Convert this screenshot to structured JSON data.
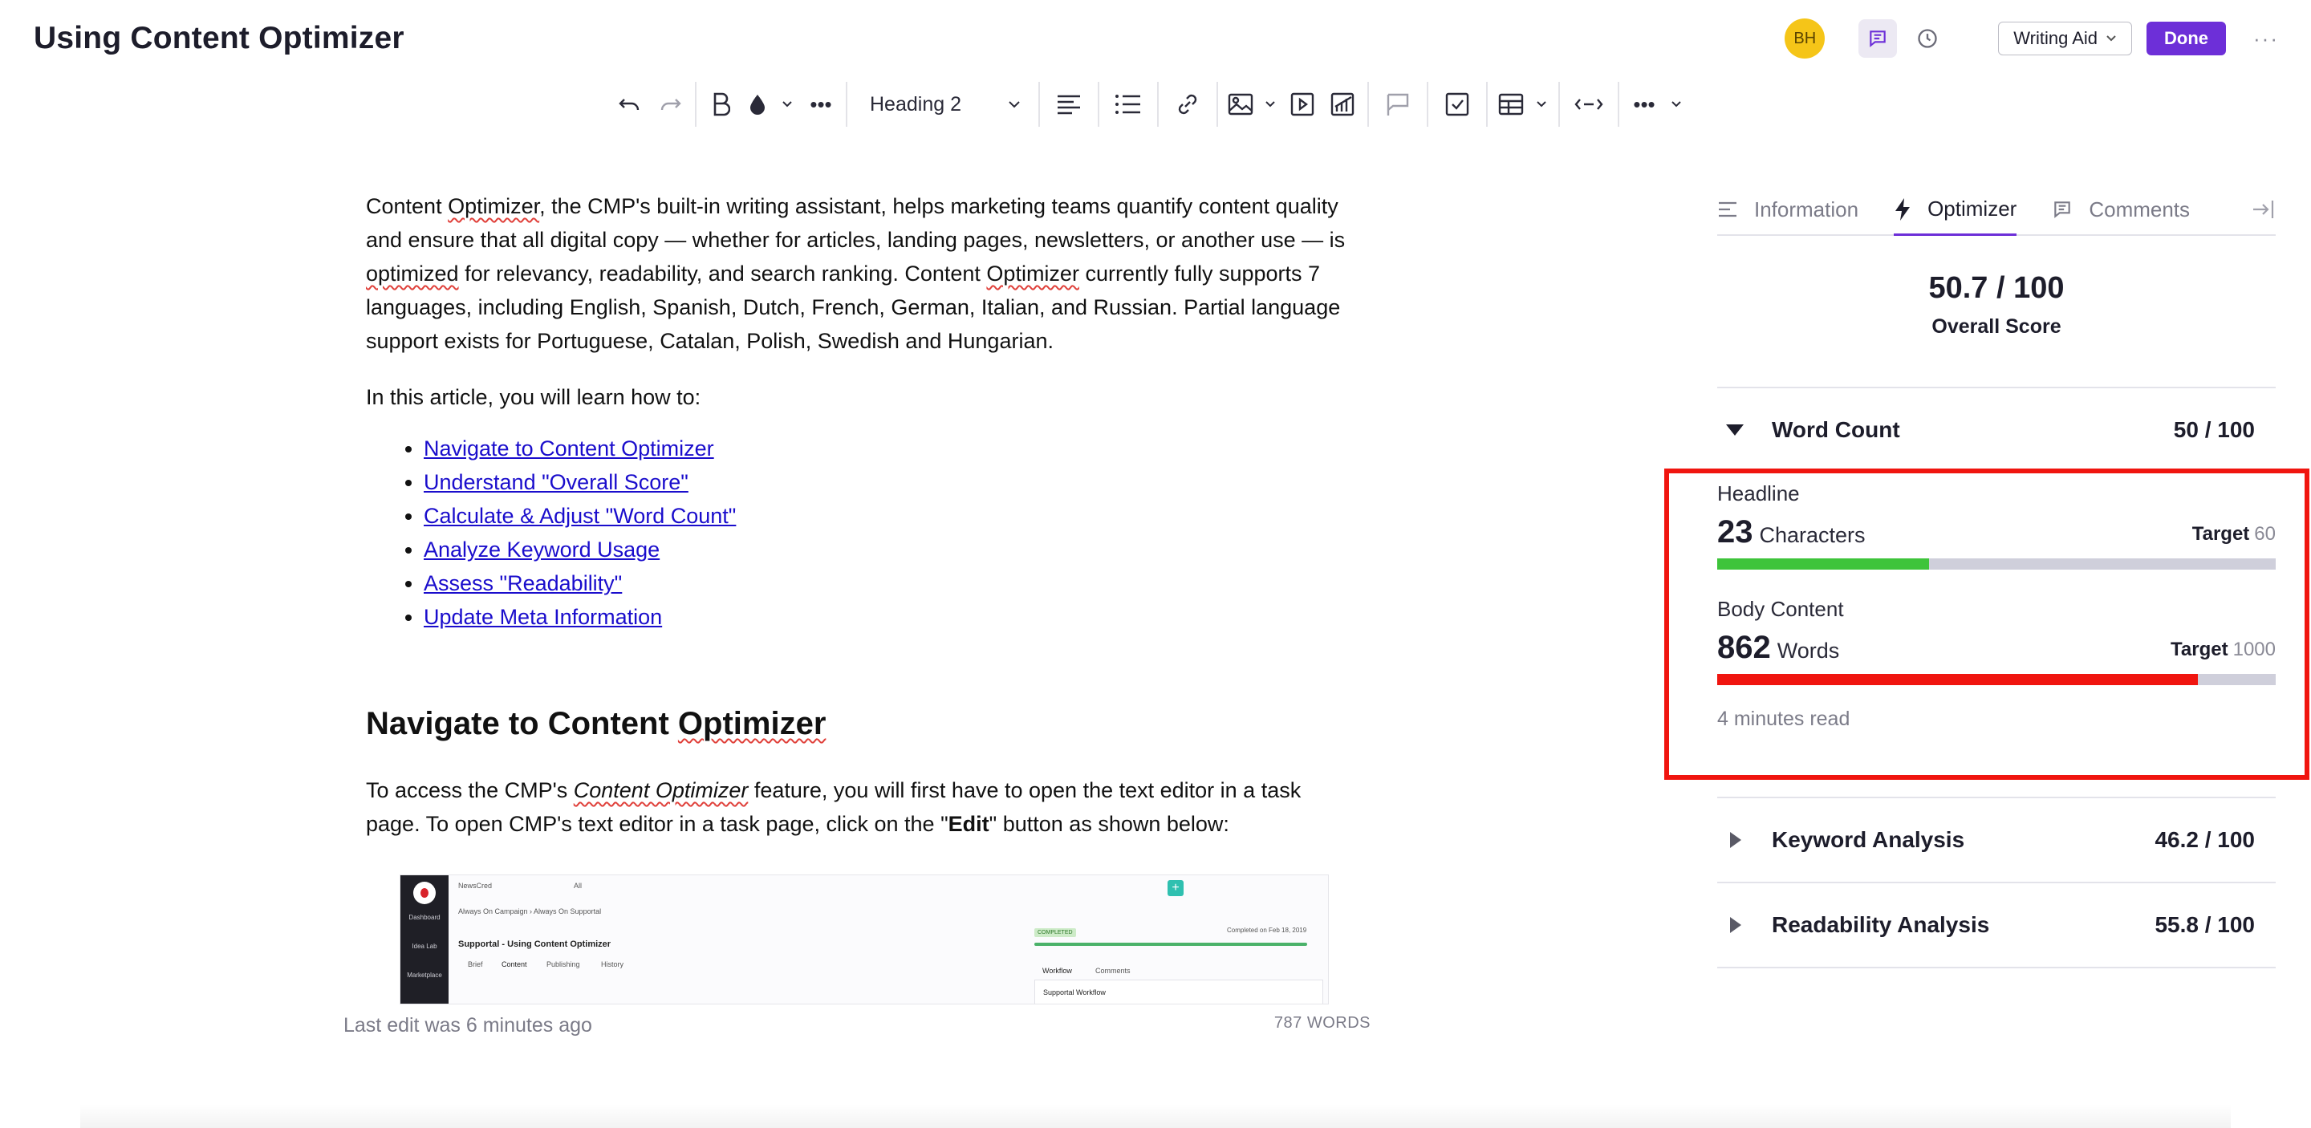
{
  "header": {
    "title": "Using Content Optimizer",
    "avatar_initials": "BH",
    "writing_aid_label": "Writing Aid",
    "done_label": "Done"
  },
  "toolbar": {
    "block_style": "Heading 2"
  },
  "document": {
    "intro_parts": [
      "Content ",
      "Optimizer",
      ", the CMP's built-in writing assistant, helps marketing teams quantify content quality and ensure that all digital copy — whether for articles, landing pages, newsletters, or another use — is ",
      "optimized",
      " for relevancy, readability, and search ranking. Content ",
      "Optimizer",
      " currently fully supports 7 languages, including English, Spanish, Dutch, French, German, Italian, and Russian. Partial language support exists for Portuguese, Catalan, Polish, Swedish and Hungarian."
    ],
    "learn_intro": "In this article, you will learn how to:",
    "links": [
      "Navigate to Content Optimizer",
      "Understand \"Overall Score\"",
      "Calculate & Adjust \"Word Count\"",
      "Analyze Keyword Usage",
      "Assess \"Readability\"",
      "Update Meta Information"
    ],
    "heading_parts": [
      "Navigate to Content ",
      "Optimizer"
    ],
    "access_parts": [
      "To access the CMP's ",
      "Content Optimizer",
      " feature, you will first have to open the text editor in a task page. To open CMP's text editor in a task page, click on the \"",
      "Edit",
      "\" button as shown below:"
    ],
    "embedded_screenshot": {
      "breadcrumb": "Always On Campaign › Always On Supportal",
      "task_title": "Supportal - Using Content Optimizer",
      "tabs": [
        "Brief",
        "Content",
        "Publishing",
        "History"
      ],
      "status": "COMPLETED",
      "completed": "Completed on Feb 18, 2019",
      "workflow_tab": "Workflow",
      "comments_tab": "Comments",
      "workflow_box": "Supportal Workflow",
      "search_placeholder": "NewsCred",
      "filter": "All",
      "side_items": [
        "Dashboard",
        "Idea Lab",
        "Marketplace"
      ]
    },
    "last_edit": "Last edit was 6 minutes ago",
    "word_count": "787 WORDS"
  },
  "panel": {
    "tabs": [
      "Information",
      "Optimizer",
      "Comments"
    ],
    "active_tab": "Optimizer",
    "overall_score": "50.7 / 100",
    "overall_label": "Overall Score",
    "word_count_section": {
      "name": "Word Count",
      "score": "50 / 100"
    },
    "headline": {
      "label": "Headline",
      "value": "23",
      "unit": "Characters",
      "target_label": "Target",
      "target": "60",
      "fill_fraction": 0.38,
      "color": "#3ec43b"
    },
    "body": {
      "label": "Body Content",
      "value": "862",
      "unit": "Words",
      "target_label": "Target",
      "target": "1000",
      "fill_fraction": 0.86,
      "color": "#f0150f"
    },
    "read_time": "4 minutes read",
    "keyword_section": {
      "name": "Keyword Analysis",
      "score": "46.2 / 100"
    },
    "readability_section": {
      "name": "Readability Analysis",
      "score": "55.8 / 100"
    }
  },
  "colors": {
    "accent": "#6d2fd8",
    "highlight": "#f0150f",
    "avatar": "#f5c518"
  }
}
